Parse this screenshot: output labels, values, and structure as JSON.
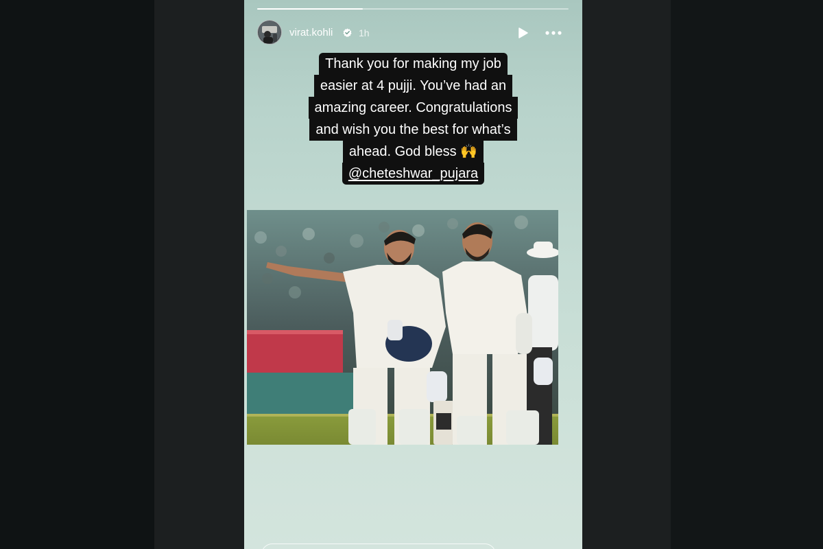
{
  "story": {
    "username": "virat.kohli",
    "time": "1h",
    "progress_fraction": 0.34,
    "caption_lines": [
      "Thank you for making my job",
      "easier at 4 pujji. You’ve had an",
      "amazing career. Congratulations",
      "and wish you the best for what’s",
      "ahead. God bless 🙌"
    ],
    "mention": "@cheteshwar_pujara"
  },
  "icons": {
    "verified": "verified-badge-icon",
    "play": "play-icon",
    "more": "more-options-icon"
  },
  "colors": {
    "verified": "#3897f0",
    "caption_bg": "#101010"
  }
}
